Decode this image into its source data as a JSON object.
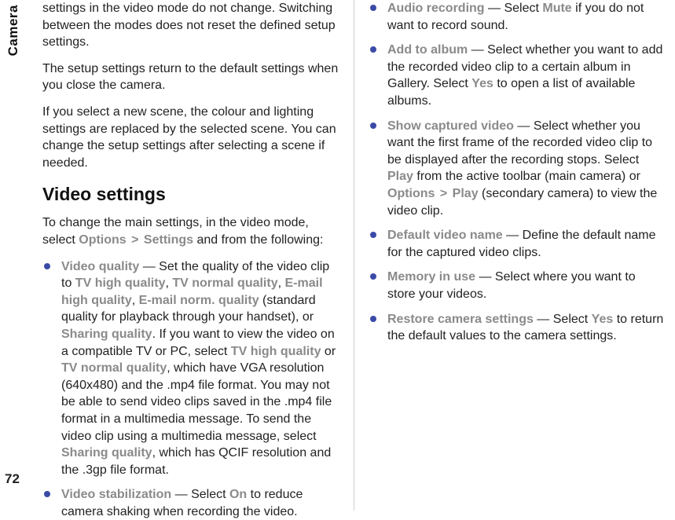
{
  "sideTab": "Camera",
  "pageNumber": "72",
  "left": {
    "para1": "settings in the video mode do not change. Switching between the modes does not reset the defined setup settings.",
    "para2": "The setup settings return to the default settings when you close the camera.",
    "para3": "If you select a new scene, the colour and lighting settings are replaced by the selected scene. You can change the setup settings after selecting a scene if needed.",
    "heading": "Video settings",
    "intro_a": "To change the main settings, in the video mode, select ",
    "intro_opt1": "Options",
    "intro_gt": " > ",
    "intro_opt2": "Settings",
    "intro_b": " and from the following:",
    "item1": {
      "label": "Video quality",
      "t1": " — Set the quality of the video clip to ",
      "v1": "TV high quality",
      "t2": ", ",
      "v2": "TV normal quality",
      "t3": ", ",
      "v3": "E-mail high quality",
      "t4": ", ",
      "v4": "E-mail norm. quality",
      "t5": " (standard quality for playback through your handset), or ",
      "v5": "Sharing quality",
      "t6": ". If you want to view the video on a compatible TV or PC, select ",
      "v6": "TV high quality",
      "t7": " or ",
      "v7": "TV normal quality",
      "t8": ", which have VGA resolution (640x480) and the .mp4 file format. You may not be able to send video clips saved in the .mp4 file format in a multimedia message. To send the video clip using a multimedia message, select ",
      "v8": "Sharing quality",
      "t9": ", which has QCIF resolution and the .3gp file format."
    },
    "item2": {
      "label": "Video stabilization",
      "t1": " — Select ",
      "v1": "On",
      "t2": " to reduce camera shaking when recording the video."
    }
  },
  "right": {
    "item1": {
      "label": "Audio recording",
      "t1": " — Select ",
      "v1": "Mute",
      "t2": " if you do not want to record sound."
    },
    "item2": {
      "label": "Add to album",
      "t1": " — Select whether you want to add the recorded video clip to a certain album in Gallery. Select ",
      "v1": "Yes",
      "t2": " to open a list of available albums."
    },
    "item3": {
      "label": "Show captured video",
      "t1": " — Select whether you want the first frame of the recorded video clip to be displayed after the recording stops. Select ",
      "v1": "Play",
      "t2": " from the active toolbar (main camera) or ",
      "v2": "Options",
      "gt": " > ",
      "v3": "Play",
      "t3": " (secondary camera) to view the video clip."
    },
    "item4": {
      "label": "Default video name",
      "t1": " — Define the default name for the captured video clips."
    },
    "item5": {
      "label": "Memory in use",
      "t1": " — Select where you want to store your videos."
    },
    "item6": {
      "label": "Restore camera settings",
      "t1": " — Select ",
      "v1": "Yes",
      "t2": " to return the default values to the camera settings."
    }
  }
}
